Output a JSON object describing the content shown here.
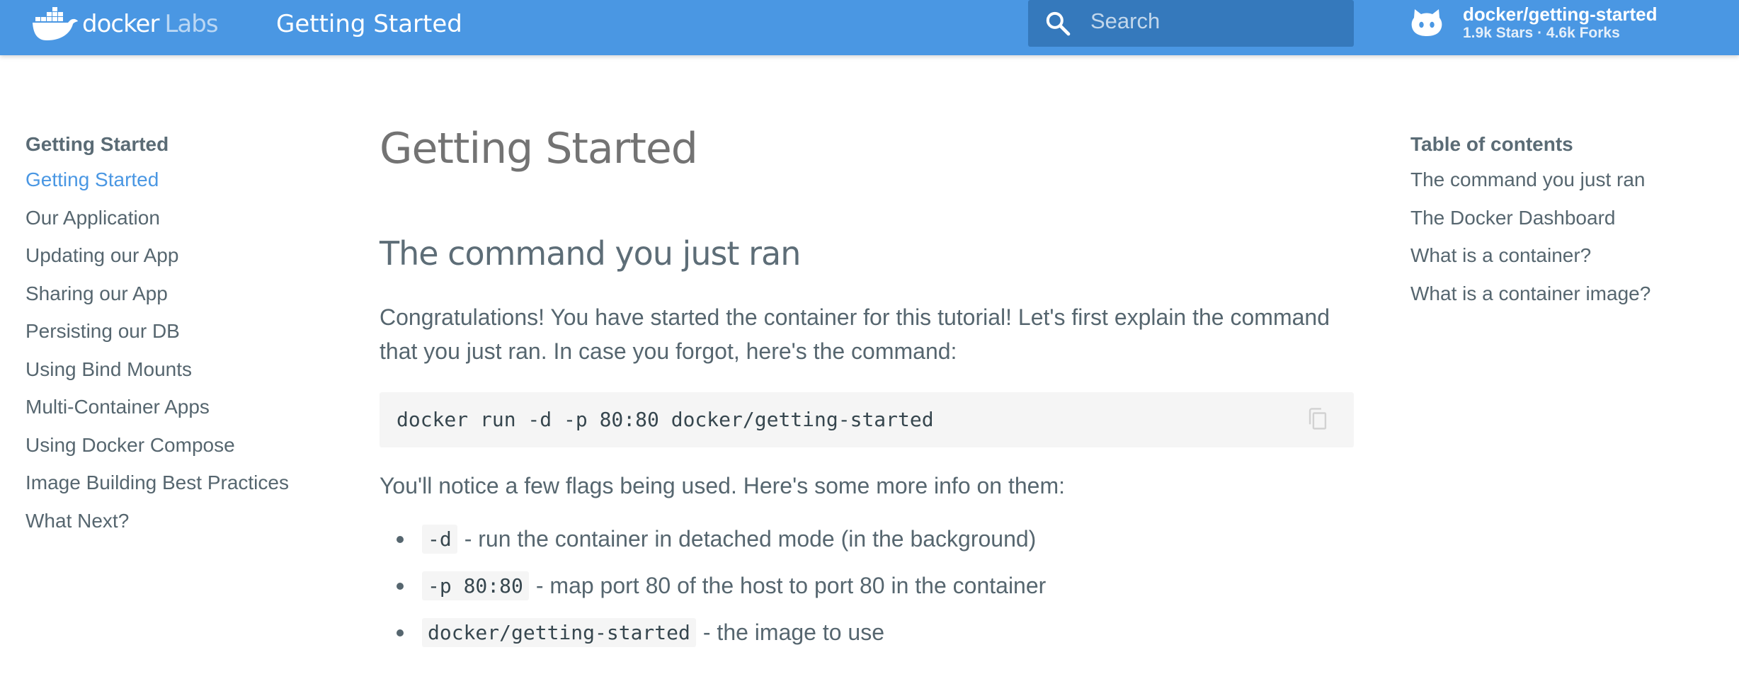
{
  "header": {
    "logo": {
      "brand": "docker",
      "suffix": "Labs",
      "icon": "docker-whale-icon"
    },
    "title": "Getting Started",
    "search": {
      "placeholder": "Search",
      "value": "",
      "icon": "search-icon"
    },
    "repo": {
      "icon": "github-octocat-icon",
      "name": "docker/getting-started",
      "stats": "1.9k Stars · 4.6k Forks"
    },
    "color": "#4a97e3"
  },
  "nav": {
    "heading": "Getting Started",
    "items": [
      {
        "label": "Getting Started",
        "active": true
      },
      {
        "label": "Our Application"
      },
      {
        "label": "Updating our App"
      },
      {
        "label": "Sharing our App"
      },
      {
        "label": "Persisting our DB"
      },
      {
        "label": "Using Bind Mounts"
      },
      {
        "label": "Multi-Container Apps"
      },
      {
        "label": "Using Docker Compose"
      },
      {
        "label": "Image Building Best Practices"
      },
      {
        "label": "What Next?"
      }
    ],
    "active_color": "#4a97e3"
  },
  "main": {
    "title": "Getting Started",
    "section_title": "The command you just ran",
    "intro": "Congratulations! You have started the container for this tutorial! Let's first explain the command that you just ran. In case you forgot, here's the command:",
    "command": "docker run -d -p 80:80 docker/getting-started",
    "copy_icon": "copy-icon",
    "flags_intro": "You'll notice a few flags being used. Here's some more info on them:",
    "flags": [
      {
        "code": "-d",
        "text": "- run the container in detached mode (in the background)"
      },
      {
        "code": "-p 80:80",
        "text": "- map port 80 of the host to port 80 in the container"
      },
      {
        "code": "docker/getting-started",
        "text": "- the image to use"
      }
    ]
  },
  "toc": {
    "heading": "Table of contents",
    "items": [
      {
        "label": "The command you just ran"
      },
      {
        "label": "The Docker Dashboard"
      },
      {
        "label": "What is a container?"
      },
      {
        "label": "What is a container image?"
      }
    ]
  }
}
